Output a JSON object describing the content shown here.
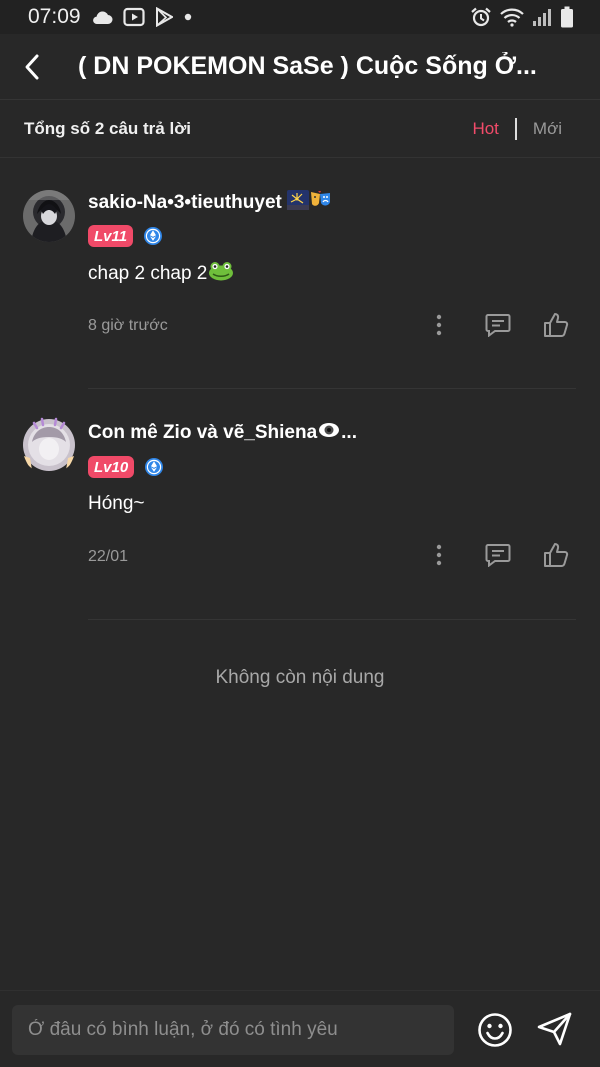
{
  "status_bar": {
    "time": "07:09",
    "left_icons": [
      "cloud-icon",
      "media-icon",
      "play-store-icon",
      "dot-icon"
    ],
    "right_icons": [
      "alarm-icon",
      "wifi-icon",
      "signal-icon",
      "battery-icon"
    ]
  },
  "header": {
    "title": "( DN POKEMON SaSe ) Cuộc Sống Ở..."
  },
  "summary": {
    "total_text": "Tổng số 2 câu trả lời",
    "sort_hot": "Hot",
    "sort_new": "Mới"
  },
  "comments": [
    {
      "username": "sakio-Na•3•tieuthuyet",
      "username_emojis": [
        "fireworks-emoji",
        "theater-masks-emoji"
      ],
      "level": "Lv11",
      "text": "chap 2 chap 2",
      "text_emoji": "frog-emoji",
      "time": "8 giờ trước"
    },
    {
      "username": "Con mê Zio và vẽ_Shiena",
      "username_emojis": [
        "eye-emoji"
      ],
      "username_suffix": "...",
      "level": "Lv10",
      "text": "Hóng~",
      "time": "22/01"
    }
  ],
  "end_text": "Không còn nội dung",
  "composer": {
    "placeholder": "Ở đâu có bình luận, ở đó có tình yêu"
  },
  "colors": {
    "background": "#282828",
    "accent": "#f24b6a",
    "level_badge": "#f04a68",
    "verify_badge": "#2f86e8"
  }
}
